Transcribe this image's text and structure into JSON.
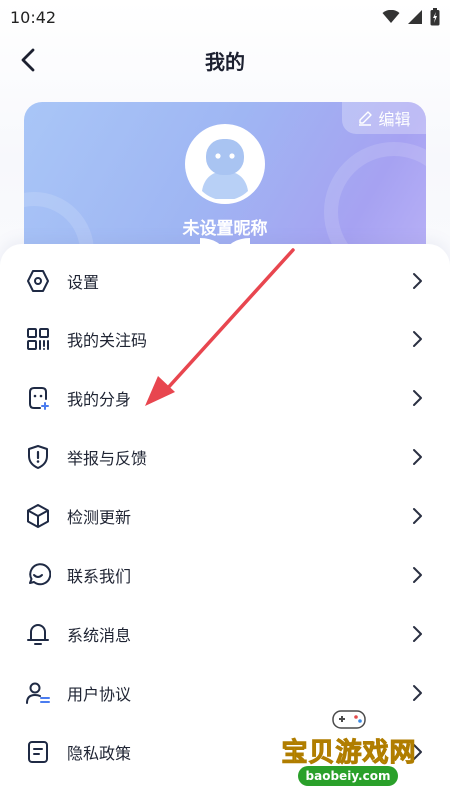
{
  "status_bar": {
    "time": "10:42"
  },
  "header": {
    "title": "我的"
  },
  "profile": {
    "edit_label": "编辑",
    "nickname": "未设置昵称"
  },
  "menu": {
    "items": [
      {
        "label": "设置",
        "icon": "settings-hexagon-icon"
      },
      {
        "label": "我的关注码",
        "icon": "qr-code-icon"
      },
      {
        "label": "我的分身",
        "icon": "clone-face-icon"
      },
      {
        "label": "举报与反馈",
        "icon": "shield-alert-icon"
      },
      {
        "label": "检测更新",
        "icon": "cube-update-icon"
      },
      {
        "label": "联系我们",
        "icon": "chat-bubble-icon"
      },
      {
        "label": "系统消息",
        "icon": "bell-icon"
      },
      {
        "label": "用户协议",
        "icon": "user-agreement-icon"
      },
      {
        "label": "隐私政策",
        "icon": "document-icon"
      }
    ]
  },
  "watermark": {
    "title": "宝贝游戏网",
    "url": "baobeiy.com"
  },
  "colors": {
    "card_gradient_start": "#a9c6f7",
    "card_gradient_end": "#b9b1f6",
    "text_primary": "#1f2433",
    "annotation_arrow": "#e8464f"
  }
}
